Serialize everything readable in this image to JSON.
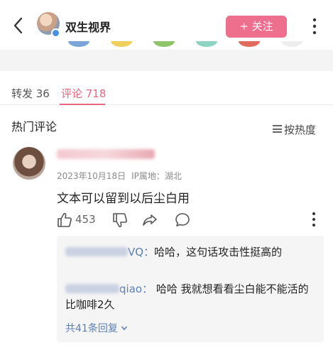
{
  "header": {
    "username": "双生视界",
    "follow_label": "+ 关注"
  },
  "colors": {
    "accent": "#ee6e8e",
    "link": "#5b7fb4"
  },
  "tabs": [
    {
      "label": "转发 36"
    },
    {
      "label": "评论 718"
    }
  ],
  "section": {
    "title": "热门评论",
    "sort_label": "按热度"
  },
  "comment": {
    "date": "2023年10月18日",
    "location": "IP属地：湖北",
    "text": "文本可以留到以后尘白用",
    "likes": "453",
    "replies": [
      {
        "name_suffix": "VQ",
        "text": "哈哈，这句话攻击性挺高的"
      },
      {
        "name_suffix": "qiao",
        "text": "哈哈 我就想看看尘白能不能活的比咖啡2久"
      }
    ],
    "total_replies": "共41条回复"
  },
  "icons": [
    "back-arrow-icon",
    "verified-icon",
    "more-icon",
    "sort-icon",
    "like-icon",
    "dislike-icon",
    "share-icon",
    "comment-icon",
    "chevron-down-icon"
  ]
}
